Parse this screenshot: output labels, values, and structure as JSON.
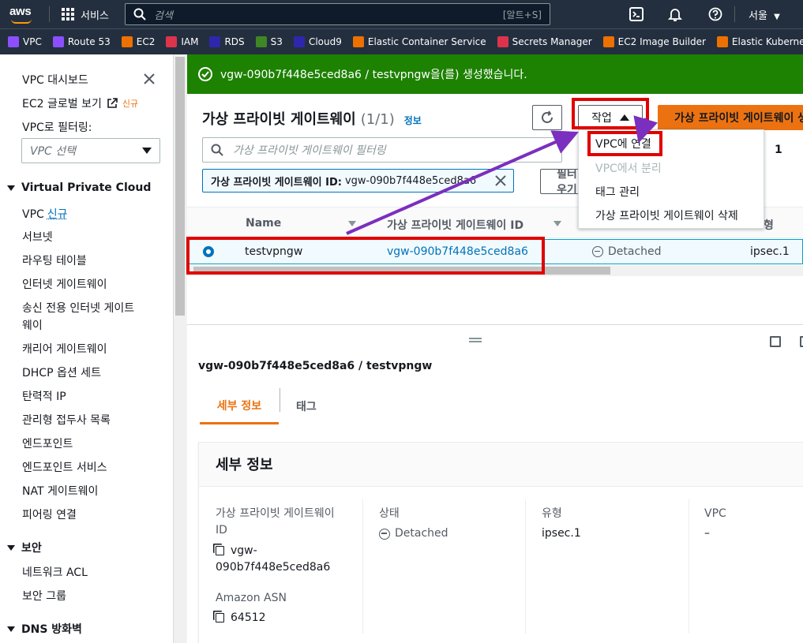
{
  "topnav": {
    "logo": "aws",
    "services": "서비스",
    "search_placeholder": "검색",
    "search_shortcut": "[알트+S]",
    "region": "서울"
  },
  "favorites": [
    {
      "label": "VPC",
      "color": "#8c4fff"
    },
    {
      "label": "Route 53",
      "color": "#8c4fff"
    },
    {
      "label": "EC2",
      "color": "#ed7100"
    },
    {
      "label": "IAM",
      "color": "#dd344c"
    },
    {
      "label": "RDS",
      "color": "#2e27ad"
    },
    {
      "label": "S3",
      "color": "#3f8624"
    },
    {
      "label": "Cloud9",
      "color": "#2e27ad"
    },
    {
      "label": "Elastic Container Service",
      "color": "#ed7100"
    },
    {
      "label": "Secrets Manager",
      "color": "#dd344c"
    },
    {
      "label": "EC2 Image Builder",
      "color": "#ed7100"
    },
    {
      "label": "Elastic Kubernetes",
      "color": "#ed7100"
    }
  ],
  "sidebar": {
    "dashboard": "VPC 대시보드",
    "ec2_global": "EC2 글로벌 보기",
    "ec2_global_badge": "신규",
    "filter_label": "VPC로 필터링:",
    "filter_placeholder": "VPC 선택",
    "section_vpc": "Virtual Private Cloud",
    "items": [
      {
        "label": "VPC",
        "badge": "신규"
      },
      {
        "label": "서브넷"
      },
      {
        "label": "라우팅 테이블"
      },
      {
        "label": "인터넷 게이트웨이"
      },
      {
        "label": "송신 전용 인터넷 게이트"
      },
      {
        "label": "웨이"
      },
      {
        "label": "캐리어 게이트웨이"
      },
      {
        "label": "DHCP 옵션 세트"
      },
      {
        "label": "탄력적 IP"
      },
      {
        "label": "관리형 접두사 목록"
      },
      {
        "label": "엔드포인트"
      },
      {
        "label": "엔드포인트 서비스"
      },
      {
        "label": "NAT 게이트웨이"
      },
      {
        "label": "피어링 연결"
      }
    ],
    "section_security": "보안",
    "security_items": [
      {
        "label": "네트워크 ACL"
      },
      {
        "label": "보안 그룹"
      }
    ],
    "section_dns": "DNS 방화벽"
  },
  "flash": {
    "message": "vgw-090b7f448e5ced8a6 / testvpngw을(를) 생성했습니다."
  },
  "panel": {
    "title": "가상 프라이빗 게이트웨이",
    "count": "(1/1)",
    "info": "정보",
    "actions_label": "작업",
    "create_label": "가상 프라이빗 게이트웨이 생성",
    "filter_placeholder": "가상 프라이빗 게이트웨이 필터링",
    "token_key": "가상 프라이빗 게이트웨이 ID:",
    "token_value": "vgw-090b7f448e5ced8a6",
    "filter_btn": "필터 지우기",
    "page": "1"
  },
  "dropdown": {
    "items": [
      {
        "label": "VPC에 연결",
        "disabled": false
      },
      {
        "label": "VPC에서 분리",
        "disabled": true
      },
      {
        "label": "태그 관리",
        "disabled": false
      },
      {
        "label": "가상 프라이빗 게이트웨이 삭제",
        "disabled": false
      }
    ]
  },
  "table": {
    "headers": [
      "Name",
      "가상 프라이빗 게이트웨이 ID",
      "상태",
      "유형"
    ],
    "rows": [
      {
        "name": "testvpngw",
        "id": "vgw-090b7f448e5ced8a6",
        "state": "Detached",
        "type": "ipsec.1"
      }
    ]
  },
  "detail": {
    "title": "vgw-090b7f448e5ced8a6 / testvpngw",
    "tabs": [
      "세부 정보",
      "태그"
    ],
    "section_title": "세부 정보",
    "fields": {
      "id_label_1": "가상 프라이빗 게이트웨이",
      "id_label_2": "ID",
      "id_value_1": "vgw-",
      "id_value_2": "090b7f448e5ced8a6",
      "asn_label": "Amazon ASN",
      "asn_value": "64512",
      "state_label": "상태",
      "state_value": "Detached",
      "type_label": "유형",
      "type_value": "ipsec.1",
      "vpc_label": "VPC",
      "vpc_value": "–"
    }
  },
  "colors": {
    "nav": "#232f3e",
    "accent": "#ec7211",
    "link": "#0073bb",
    "success": "#1d8102",
    "annotation_red": "#e00000",
    "annotation_arrow": "#7b2fbe"
  }
}
